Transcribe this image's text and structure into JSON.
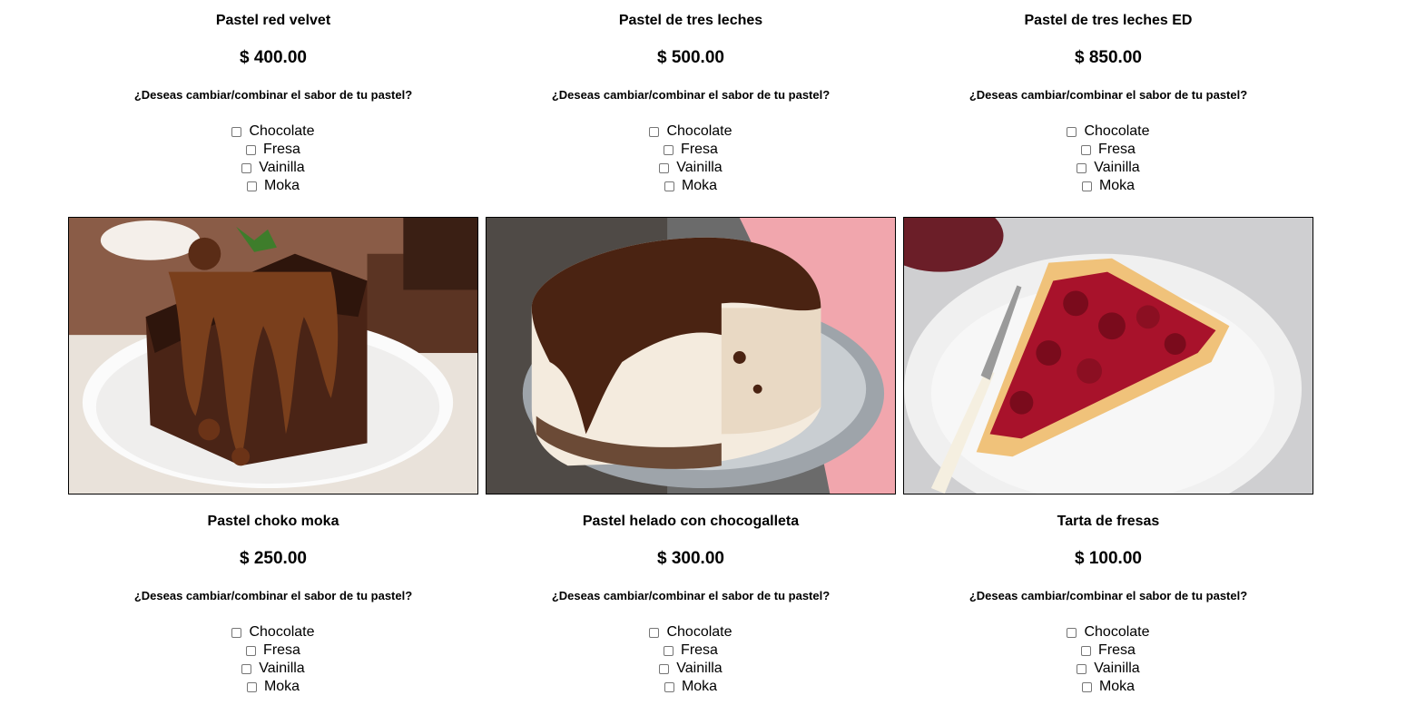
{
  "question": "¿Deseas cambiar/combinar el sabor de tu pastel?",
  "flavors": [
    "Chocolate",
    "Fresa",
    "Vainilla",
    "Moka"
  ],
  "products": [
    {
      "name": "Pastel red velvet",
      "price": "$ 400.00"
    },
    {
      "name": "Pastel de tres leches",
      "price": "$ 500.00"
    },
    {
      "name": "Pastel de tres leches ED",
      "price": "$ 850.00"
    },
    {
      "name": "Pastel choko moka",
      "price": "$ 250.00"
    },
    {
      "name": "Pastel helado con chocogalleta",
      "price": "$ 300.00"
    },
    {
      "name": "Tarta de fresas",
      "price": "$ 100.00"
    }
  ],
  "images": [
    "chocolate-cake-slice-photo",
    "chocolate-ice-cream-cake-photo",
    "cherry-tart-slice-photo"
  ]
}
